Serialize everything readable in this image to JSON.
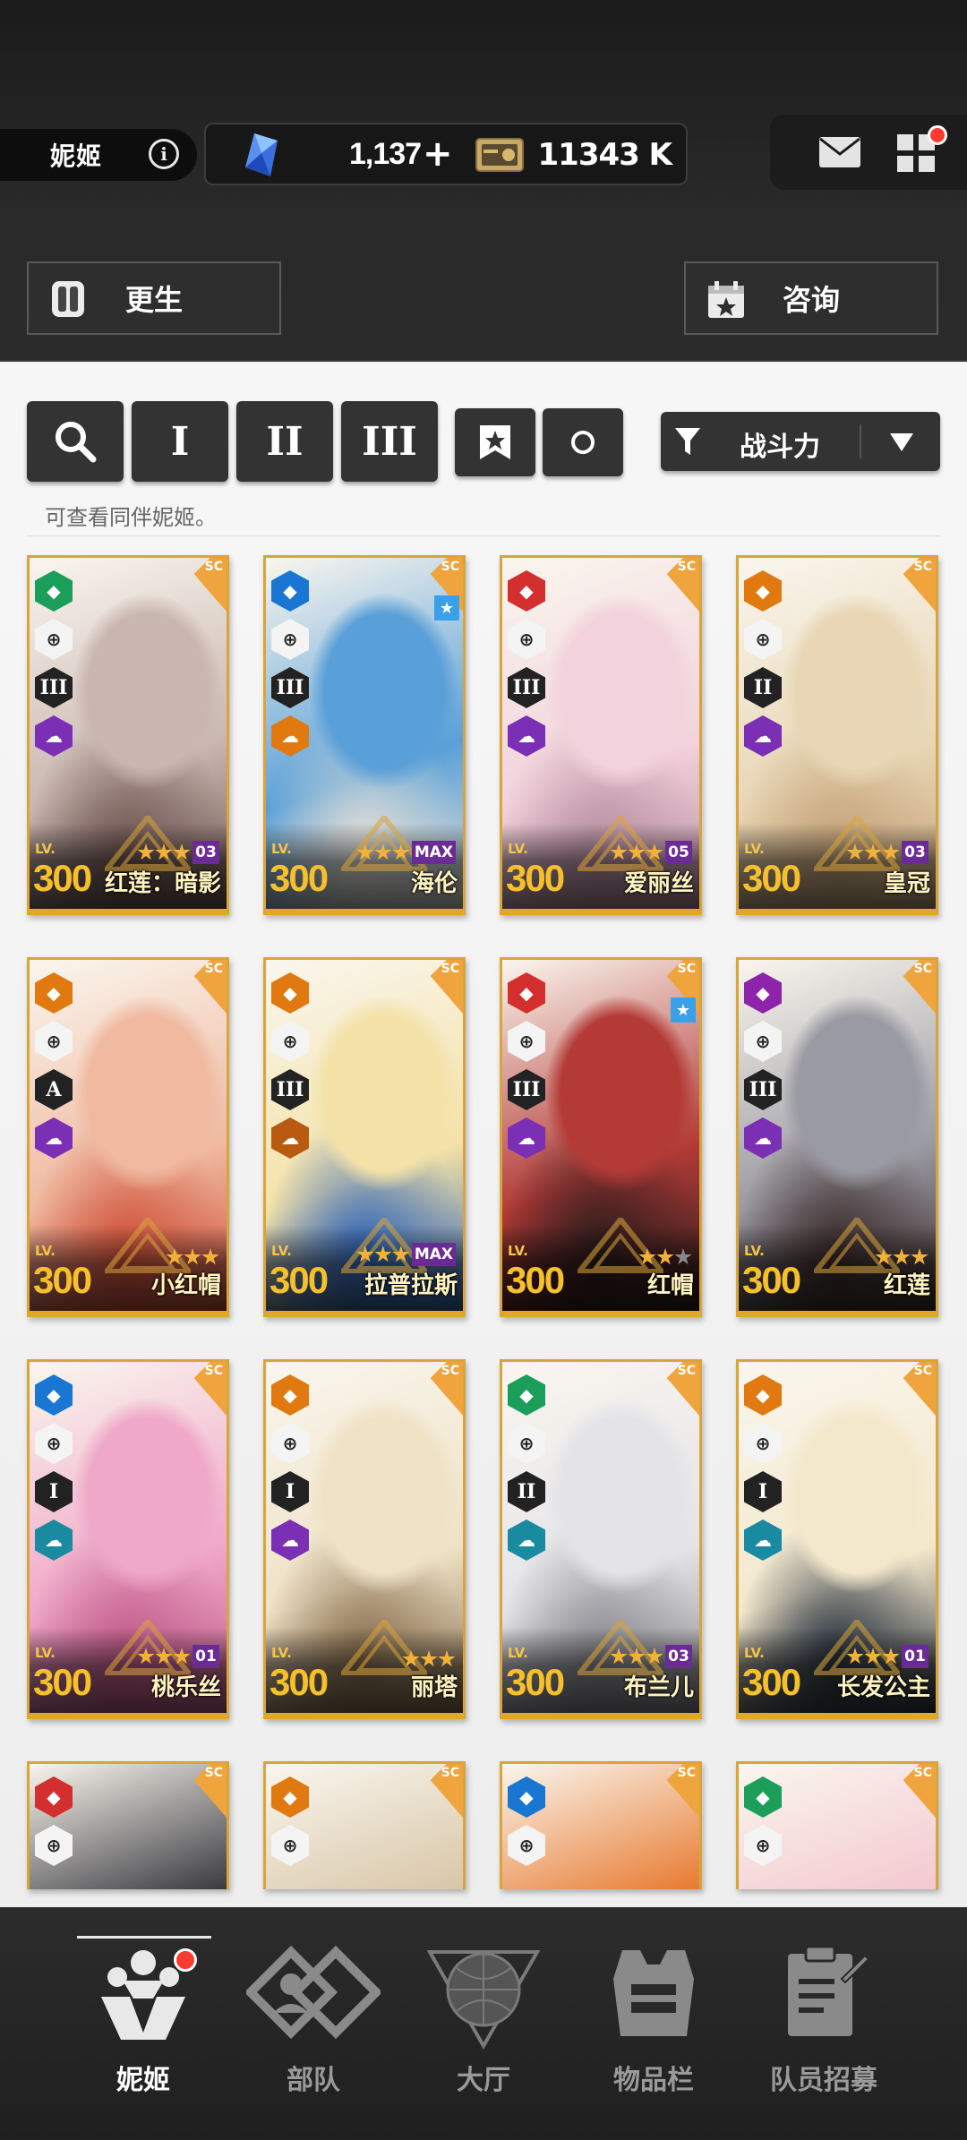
{
  "header": {
    "title": "妮姬",
    "gems": "1,137",
    "gems_plus": "+",
    "credits": "11343 K"
  },
  "actions": {
    "rebirth_label": "更生",
    "consult_label": "咨询"
  },
  "filters": {
    "burst_1": "I",
    "burst_2": "II",
    "burst_3": "III",
    "sort_label": "战斗力",
    "hint": "可查看同伴妮姬。"
  },
  "characters": [
    {
      "name": "红莲：暗影",
      "level": "300",
      "limit": "03",
      "element_color": "#1a9e5a",
      "element_icon": "wind-icon",
      "burst": "III"
    },
    {
      "name": "海伦",
      "level": "300",
      "limit": "MAX",
      "element_color": "#1976d2",
      "element_icon": "water-icon",
      "burst": "III"
    },
    {
      "name": "爱丽丝",
      "level": "300",
      "limit": "05",
      "element_color": "#d32f2f",
      "element_icon": "fire-icon",
      "burst": "III"
    },
    {
      "name": "皇冠",
      "level": "300",
      "limit": "03",
      "element_color": "#e07a10",
      "element_icon": "iron-icon",
      "burst": "II"
    },
    {
      "name": "小红帽",
      "level": "300",
      "limit": "",
      "element_color": "#e07a10",
      "element_icon": "iron-icon",
      "burst": "A"
    },
    {
      "name": "拉普拉斯",
      "level": "300",
      "limit": "MAX",
      "element_color": "#e07a10",
      "element_icon": "iron-icon",
      "burst": "III"
    },
    {
      "name": "红帽",
      "level": "300",
      "limit": "",
      "element_color": "#d32f2f",
      "element_icon": "fire-icon",
      "burst": "III"
    },
    {
      "name": "红莲",
      "level": "300",
      "limit": "",
      "element_color": "#8e24aa",
      "element_icon": "electric-icon",
      "burst": "III"
    },
    {
      "name": "桃乐丝",
      "level": "300",
      "limit": "01",
      "element_color": "#1976d2",
      "element_icon": "water-icon",
      "burst": "I"
    },
    {
      "name": "丽塔",
      "level": "300",
      "limit": "",
      "element_color": "#e07a10",
      "element_icon": "iron-icon",
      "burst": "I"
    },
    {
      "name": "布兰儿",
      "level": "300",
      "limit": "03",
      "element_color": "#1a9e5a",
      "element_icon": "wind-icon",
      "burst": "II"
    },
    {
      "name": "长发公主",
      "level": "300",
      "limit": "01",
      "element_color": "#e07a10",
      "element_icon": "iron-icon",
      "burst": "I"
    }
  ],
  "level_prefix": "LV.",
  "sc_badge": "SC",
  "nav": [
    {
      "label": "妮姬"
    },
    {
      "label": "部队"
    },
    {
      "label": "大厅"
    },
    {
      "label": "物品栏"
    },
    {
      "label": "队员招募"
    }
  ]
}
